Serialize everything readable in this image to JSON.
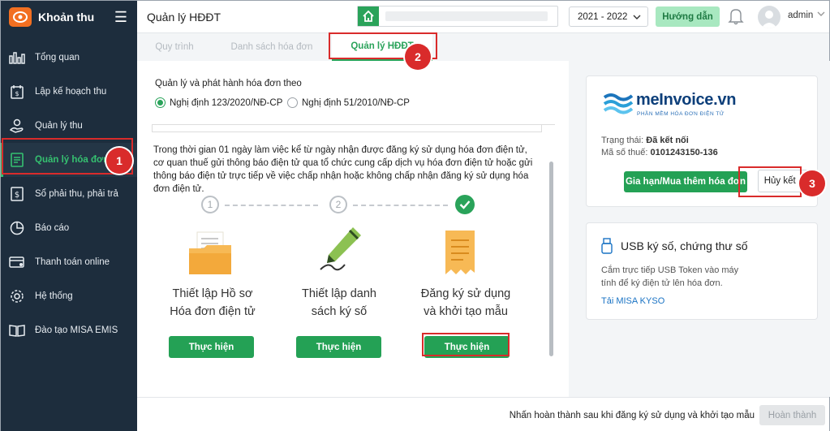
{
  "app": {
    "name": "Khoản thu"
  },
  "sidebar": {
    "items": [
      {
        "label": "Tổng quan",
        "icon": "chart-bars-icon"
      },
      {
        "label": "Lập kế hoạch thu",
        "icon": "calendar-money-icon"
      },
      {
        "label": "Quản lý thu",
        "icon": "hand-coin-icon"
      },
      {
        "label": "Quản lý hóa đơn",
        "icon": "invoice-icon",
        "active": true
      },
      {
        "label": "Sổ phải thu, phải trả",
        "icon": "ledger-icon"
      },
      {
        "label": "Báo cáo",
        "icon": "pie-chart-icon"
      },
      {
        "label": "Thanh toán online",
        "icon": "card-payment-icon"
      },
      {
        "label": "Hệ thống",
        "icon": "gear-icon"
      },
      {
        "label": "Đào tạo MISA EMIS",
        "icon": "book-icon"
      }
    ]
  },
  "header": {
    "title": "Quản lý HĐĐT",
    "year": "2021 - 2022",
    "guide_label": "Hướng dẫn",
    "user": "admin"
  },
  "tabs": [
    {
      "label": "Quy trình"
    },
    {
      "label": "Danh sách hóa đơn"
    },
    {
      "label": "Quản lý HĐĐT",
      "active": true
    }
  ],
  "main": {
    "section_label": "Quản lý và phát hành hóa đơn theo",
    "options": [
      {
        "label": "Nghị định 123/2020/NĐ-CP",
        "checked": true
      },
      {
        "label": "Nghị định 51/2010/NĐ-CP",
        "checked": false
      }
    ],
    "description": "Trong thời gian 01 ngày làm việc kể từ ngày nhận được đăng ký sử dụng hóa đơn điện tử, cơ quan thuế gửi thông báo điện tử qua tổ chức cung cấp dịch vụ hóa đơn điện tử hoặc gửi thông báo điện tử trực tiếp về việc chấp nhận hoặc không chấp nhận đăng ký sử dụng hóa đơn điện tử.",
    "steps": [
      {
        "number": "1",
        "title_line1": "Thiết lập Hồ sơ",
        "title_line2": "Hóa đơn điện tử",
        "button": "Thực hiện",
        "done": false
      },
      {
        "number": "2",
        "title_line1": "Thiết lập danh",
        "title_line2": "sách ký số",
        "button": "Thực hiện",
        "done": false
      },
      {
        "number": "3",
        "title_line1": "Đăng ký sử dụng",
        "title_line2": "và khởi tạo mẫu",
        "button": "Thực hiện",
        "done": true
      }
    ]
  },
  "meinvoice": {
    "brand": "meInvoice.vn",
    "tagline": "PHẦN MỀM HÓA ĐƠN ĐIỆN TỬ",
    "status_label": "Trạng thái:",
    "status_value": "Đã kết nối",
    "tax_label": "Mã số thuế:",
    "tax_value": "0101243150-136",
    "renew_label": "Gia hạn/Mua thêm hóa đơn",
    "disconnect_label": "Hủy kết nối"
  },
  "usb": {
    "title": "USB ký số, chứng thư số",
    "description": "Cắm trực tiếp USB Token vào máy tính để ký điện tử lên hóa đơn.",
    "link": "Tải MISA KYSO"
  },
  "footer": {
    "note": "Nhấn hoàn thành sau khi đăng ký sử dụng và khởi tạo mẫu",
    "finish_label": "Hoàn thành"
  },
  "annotations": [
    "1",
    "2",
    "3"
  ],
  "colors": {
    "sidebar_bg": "#1d2d3d",
    "accent_green": "#24a155",
    "highlight_red": "#d92b2b",
    "brand_orange": "#f26f21"
  }
}
